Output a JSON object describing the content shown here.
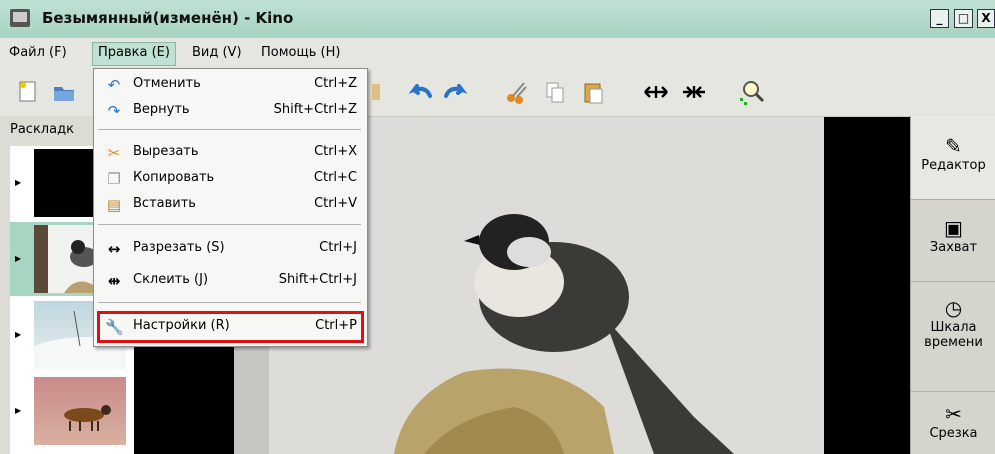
{
  "window": {
    "title": "Безымянный(изменён) - Kino",
    "buttons": {
      "minimize": "_",
      "maximize": "□",
      "close": "X"
    }
  },
  "menubar": {
    "items": [
      {
        "label": "Файл (F)"
      },
      {
        "label": "Правка (E)"
      },
      {
        "label": "Вид (V)"
      },
      {
        "label": "Помощь (H)"
      }
    ]
  },
  "toolbar": {
    "icons": [
      "new-file-icon",
      "open-folder-icon",
      "undo-icon",
      "redo-icon",
      "cut-icon",
      "copy-icon",
      "paste-icon",
      "split-icon",
      "join-icon",
      "zoom-icon"
    ]
  },
  "edit_menu": {
    "items": [
      {
        "icon": "undo-icon",
        "label": "Отменить",
        "shortcut": "Ctrl+Z"
      },
      {
        "icon": "redo-icon",
        "label": "Вернуть",
        "shortcut": "Shift+Ctrl+Z"
      },
      {
        "icon": "cut-icon",
        "label": "Вырезать",
        "shortcut": "Ctrl+X"
      },
      {
        "icon": "copy-icon",
        "label": "Копировать",
        "shortcut": "Ctrl+C"
      },
      {
        "icon": "paste-icon",
        "label": "Вставить",
        "shortcut": "Ctrl+V"
      },
      {
        "icon": "split-icon",
        "label": "Разрезать (S)",
        "shortcut": "Ctrl+J"
      },
      {
        "icon": "join-icon",
        "label": "Склеить (J)",
        "shortcut": "Shift+Ctrl+J"
      },
      {
        "icon": "wrench-icon",
        "label": "Настройки (R)",
        "shortcut": "Ctrl+P"
      }
    ],
    "highlighted_item": "Настройки (R)"
  },
  "left_panel": {
    "label": "Раскладк",
    "thumbnails": [
      "black",
      "bird",
      "snow",
      "dog"
    ],
    "selected_index": 1
  },
  "right_panel": {
    "tabs": [
      {
        "icon": "editor-icon",
        "label": "Редактор"
      },
      {
        "icon": "camera-icon",
        "label": "Захват"
      },
      {
        "icon": "clock-icon",
        "label": "Шкала времени"
      },
      {
        "icon": "trim-icon",
        "label": "Срезка"
      }
    ],
    "active_tab": "Редактор"
  },
  "colors": {
    "titlebar": "#a7d3c1",
    "selection": "#bfe0d2",
    "highlight_box": "#dd1111"
  }
}
